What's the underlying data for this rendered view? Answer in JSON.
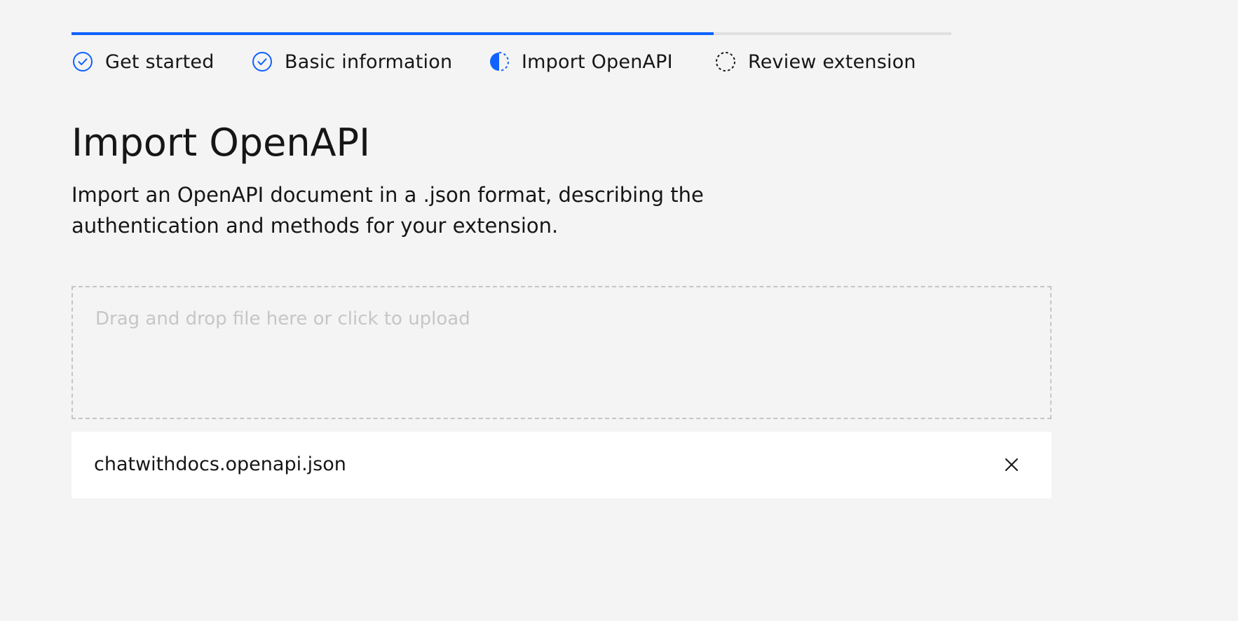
{
  "progress": {
    "completed_fraction": 0.73,
    "accent_color": "#0f62fe",
    "steps": [
      {
        "label": "Get started",
        "state": "complete",
        "icon": "checkmark-circle-icon"
      },
      {
        "label": "Basic information",
        "state": "complete",
        "icon": "checkmark-circle-icon"
      },
      {
        "label": "Import OpenAPI",
        "state": "current",
        "icon": "half-filled-circle-icon"
      },
      {
        "label": "Review extension",
        "state": "incomplete",
        "icon": "dashed-circle-icon"
      }
    ]
  },
  "page": {
    "title": "Import OpenAPI",
    "description": "Import an OpenAPI document in a .json format, describing the authentication and methods for your extension."
  },
  "dropzone": {
    "placeholder": "Drag and drop file here or click to upload"
  },
  "file": {
    "name": "chatwithdocs.openapi.json",
    "remove_icon": "close-icon"
  }
}
